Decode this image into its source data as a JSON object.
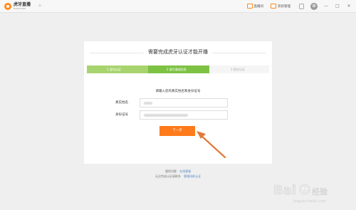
{
  "app": {
    "logo_name": "虎牙直播",
    "logo_domain": "huya.com",
    "new_tab": "+"
  },
  "toolbar": {
    "items": [
      {
        "label": "直播间",
        "icon": "monitor-icon"
      },
      {
        "label": "装扮管理",
        "icon": "gift-icon"
      }
    ],
    "user_icon": "user-icon",
    "window_controls": [
      "—",
      "□",
      "✕"
    ]
  },
  "card": {
    "title": "需要完成虎牙认证才能开播",
    "steps": [
      {
        "label": "1 身份认证",
        "state": "done"
      },
      {
        "label": "2 填写基础信息",
        "state": "active"
      },
      {
        "label": "3 提交认证",
        "state": "pending"
      }
    ],
    "hint": "请输入您的真实姓名和身份证号",
    "fields": [
      {
        "label": "真实姓名",
        "value": ""
      },
      {
        "label": "身份证号",
        "value": ""
      }
    ],
    "submit_label": "下一步"
  },
  "footer": {
    "line1_text": "遇到问题",
    "line1_link": "在线客服",
    "line2_text": "无法完成认证请联系",
    "line2_link": "客服协助认证"
  },
  "colors": {
    "accent": "#ff7a1a",
    "step_done": "#a8d46f",
    "step_active": "#7ec244",
    "annotation_arrow": "#e07a3c"
  },
  "watermark": {
    "brand": "Bai",
    "sub": "经验",
    "url": "jingyan.baidu.com"
  }
}
